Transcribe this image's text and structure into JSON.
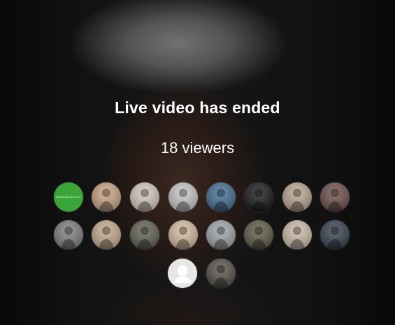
{
  "screen": {
    "title": "Live video has ended",
    "viewers_text": "18 viewers"
  },
  "viewer_avatars": [
    {
      "kind": "green-brand",
      "label": "#lightsidproductions",
      "color": "#3aa63a"
    },
    {
      "kind": "photo",
      "color": "#c9a27f"
    },
    {
      "kind": "photo",
      "color": "#d8c7bf"
    },
    {
      "kind": "photo",
      "color": "#c7c7c7"
    },
    {
      "kind": "photo",
      "color": "#3b6a8f"
    },
    {
      "kind": "photo",
      "color": "#0f0f12"
    },
    {
      "kind": "photo",
      "color": "#bba48e"
    },
    {
      "kind": "photo",
      "color": "#6a4a44"
    },
    {
      "kind": "photo",
      "color": "#7a7a7a"
    },
    {
      "kind": "photo",
      "color": "#c5a88a"
    },
    {
      "kind": "photo",
      "color": "#5b5b4d"
    },
    {
      "kind": "photo",
      "color": "#d6bca0"
    },
    {
      "kind": "photo",
      "color": "#9ea4a8"
    },
    {
      "kind": "photo",
      "color": "#57543d"
    },
    {
      "kind": "photo",
      "color": "#cdbca8"
    },
    {
      "kind": "photo",
      "color": "#2f3a4a"
    },
    {
      "kind": "default-user",
      "color": "#e6e6e6"
    },
    {
      "kind": "photo",
      "color": "#4f4a44"
    }
  ]
}
